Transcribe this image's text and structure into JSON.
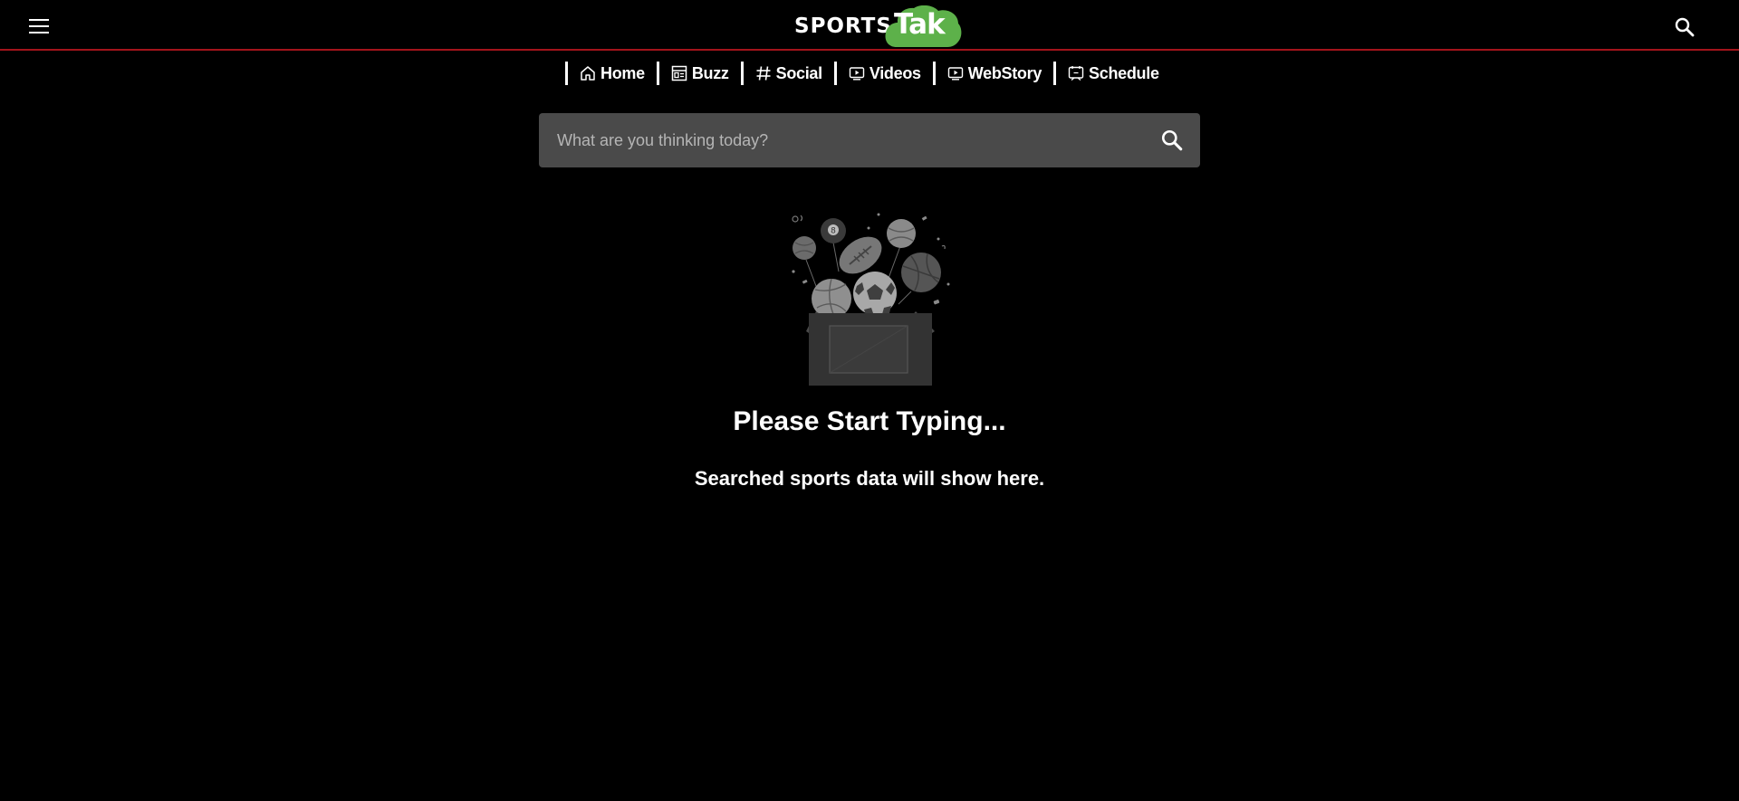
{
  "header": {
    "logo_sports": "SPORTS",
    "logo_tak": "Tak",
    "brand_green": "#5db14a",
    "divider_color": "#a3141b",
    "menu_icon": "hamburger-menu-icon",
    "search_icon": "search-icon"
  },
  "nav": {
    "items": [
      {
        "label": "Home",
        "icon": "home-icon"
      },
      {
        "label": "Buzz",
        "icon": "buzz-icon"
      },
      {
        "label": "Social",
        "icon": "hashtag-icon"
      },
      {
        "label": "Videos",
        "icon": "video-icon"
      },
      {
        "label": "WebStory",
        "icon": "webstory-icon"
      },
      {
        "label": "Schedule",
        "icon": "calendar-icon"
      }
    ]
  },
  "search": {
    "placeholder": "What are you thinking today?",
    "value": "",
    "icon": "search-icon"
  },
  "empty_state": {
    "illustration": "sports-balls-box-icon",
    "title": "Please Start Typing...",
    "subtitle": "Searched sports data will show here."
  }
}
